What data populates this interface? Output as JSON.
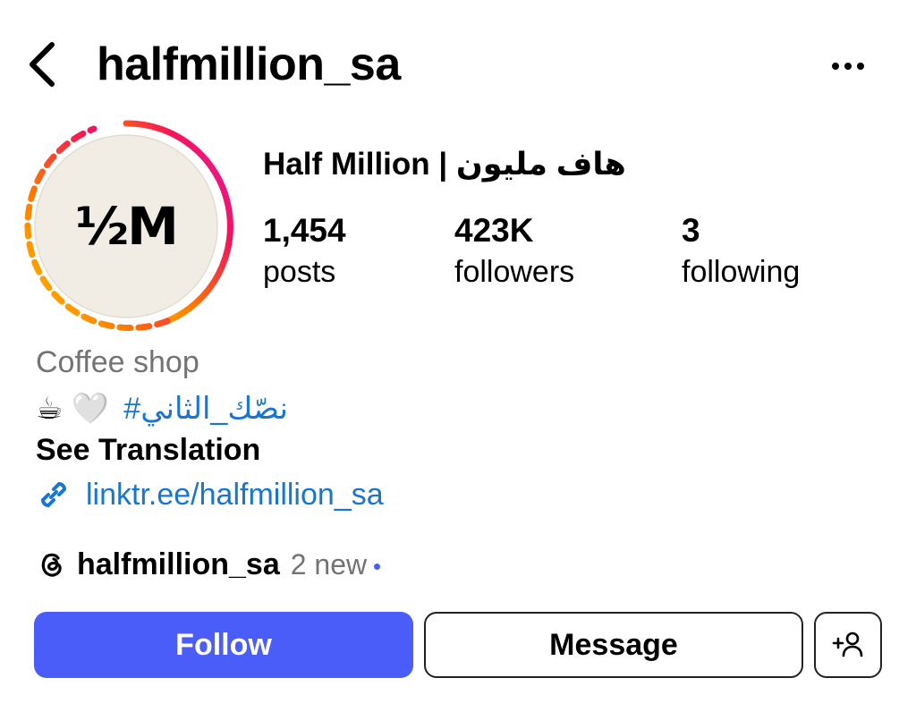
{
  "header": {
    "username": "halfmillion_sa",
    "back_icon": "chevron-left-icon",
    "more_icon": "more-horizontal-icon"
  },
  "profile": {
    "avatar_text": "½M",
    "avatar_bg": "#f2ede4",
    "story_ring_colors": [
      "#ffc400",
      "#ff7a00",
      "#f4145a",
      "#e01ab6"
    ],
    "display_name": "Half Million | هاف مليون"
  },
  "stats": [
    {
      "value": "1,454",
      "label": "posts"
    },
    {
      "value": "423K",
      "label": "followers"
    },
    {
      "value": "3",
      "label": "following"
    }
  ],
  "bio": {
    "category": "Coffee shop",
    "hashtag": "#نصّك_الثاني",
    "emojis": "☕ 🤍",
    "see_translation": "See Translation",
    "link": "linktr.ee/halfmillion_sa",
    "link_icon": "link-icon"
  },
  "threads": {
    "icon": "threads-icon",
    "username": "halfmillion_sa",
    "new_count": "2 new"
  },
  "actions": {
    "follow": "Follow",
    "message": "Message",
    "add_user_icon": "add-person-icon",
    "follow_color": "#4a5df8"
  }
}
